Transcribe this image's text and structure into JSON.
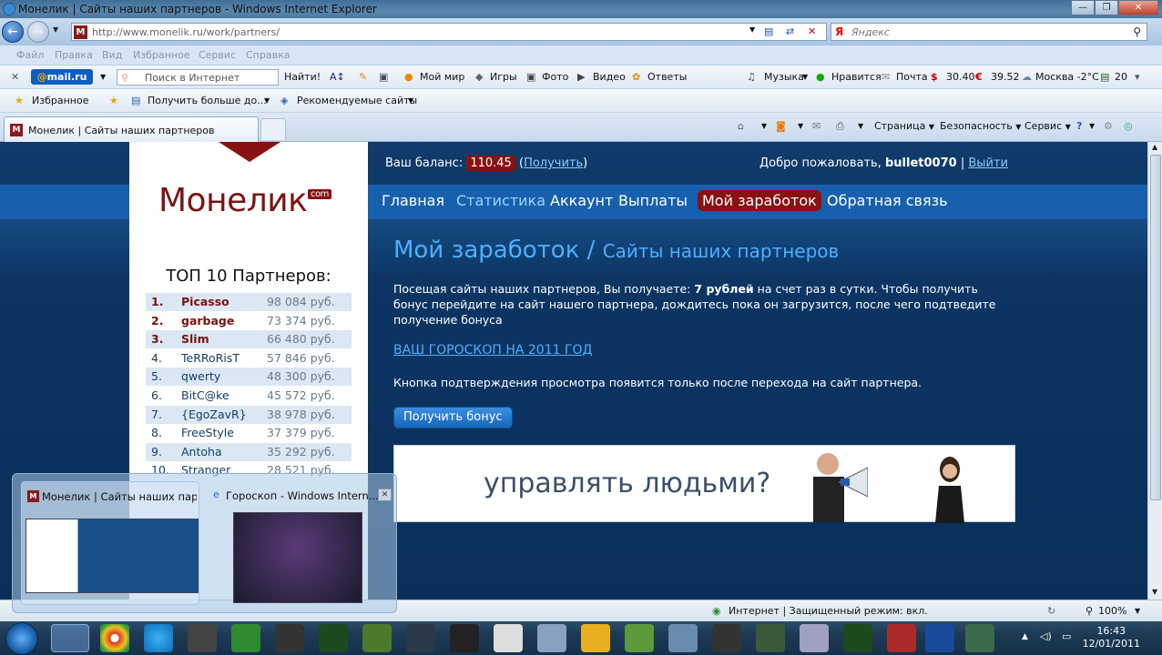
{
  "window": {
    "title": "Монелик | Сайты наших партнеров - Windows Internet Explorer"
  },
  "address": {
    "url": "http://www.monelik.ru/work/partners/",
    "search_placeholder": "Яндекс",
    "search_engine_icon": "Я"
  },
  "menu": [
    "Файл",
    "Правка",
    "Вид",
    "Избранное",
    "Сервис",
    "Справка"
  ],
  "mailru_toolbar": {
    "logo_prefix": "@",
    "logo_brand": "mail",
    "logo_suffix": ".ru",
    "search_placeholder": "Поиск в Интернет",
    "find": "Найти!",
    "items": [
      "Мой мир",
      "Игры",
      "Фото",
      "Видео",
      "Ответы"
    ],
    "right": {
      "music": "Музыка",
      "like": "Нравится",
      "mail": "Почта",
      "usd": "30.40",
      "eur": "39.52",
      "weather": "Москва -2°C",
      "count": "20"
    }
  },
  "favorites_bar": {
    "favorites": "Избранное",
    "get_more": "Получить больше до...",
    "recommended": "Рекомендуемые сайты"
  },
  "tab": {
    "title": "Монелик | Сайты наших партнеров"
  },
  "command_bar": {
    "page": "Страница",
    "security": "Безопасность",
    "service": "Сервис"
  },
  "site": {
    "logo": "Монелик",
    "logo_tld": "com",
    "balance_label": "Ваш баланс:",
    "balance_value": "110.45",
    "get_link": "Получить",
    "welcome": "Добро пожаловать,",
    "username": "bullet0070",
    "logout": "Выйти",
    "nav": [
      "Главная",
      "Статистика",
      "Аккаунт",
      "Выплаты",
      "Мой заработок",
      "Обратная связь"
    ],
    "heading_main": "Мой заработок",
    "heading_sub": "Сайты наших партнеров",
    "para1_a": "Посещая сайты наших партнеров, Вы получаете:",
    "para1_b": "7 рублей",
    "para1_c": "на счет раз в сутки. Чтобы получить бонус перейдите на сайт нашего партнера, дождитесь пока он загрузится, после чего подтведите получение бонуса",
    "partner_link": "ВАШ ГОРОСКОП НА 2011 ГОД",
    "note": "Кнопка подтверждения просмотра появится только после перехода на сайт партнера.",
    "bonus_button": "Получить бонус",
    "banner_text": "управлять людьми?",
    "top_title": "ТОП 10 Партнеров:",
    "top": [
      {
        "n": "1.",
        "name": "Picasso",
        "value": "98 084 руб."
      },
      {
        "n": "2.",
        "name": "garbage",
        "value": "73 374 руб."
      },
      {
        "n": "3.",
        "name": "Slim",
        "value": "66 480 руб."
      },
      {
        "n": "4.",
        "name": "TeRRoRisT",
        "value": "57 846 руб."
      },
      {
        "n": "5.",
        "name": "qwerty",
        "value": "48 300 руб."
      },
      {
        "n": "6.",
        "name": "BitC@ke",
        "value": "45 572 руб."
      },
      {
        "n": "7.",
        "name": "{EgoZavR}",
        "value": "38 978 руб."
      },
      {
        "n": "8.",
        "name": "FreeStyle",
        "value": "37 379 руб."
      },
      {
        "n": "9.",
        "name": "Antoha",
        "value": "35 292 руб."
      },
      {
        "n": "10.",
        "name": "Stranger",
        "value": "28 521 руб."
      }
    ]
  },
  "statusbar": {
    "zone": "Интернет | Защищенный режим: вкл.",
    "zoom": "100%"
  },
  "taskbar_preview": {
    "item1": "Монелик | Сайты наших партн...",
    "item2": "Гороскоп - Windows Intern..."
  },
  "clock": {
    "time": "16:43",
    "date": "12/01/2011"
  }
}
